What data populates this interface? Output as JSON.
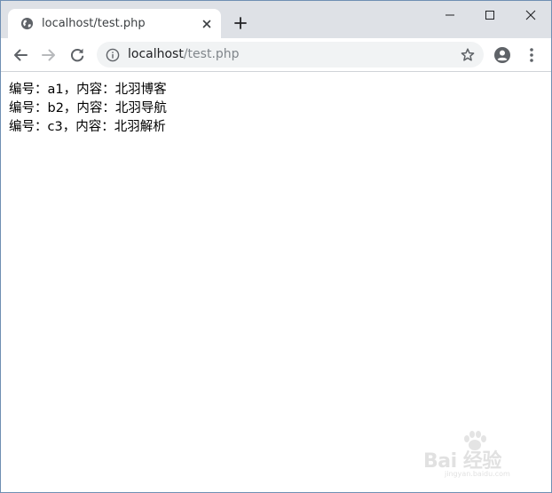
{
  "tab": {
    "title": "localhost/test.php",
    "favicon": "globe-icon",
    "close_icon": "close-icon"
  },
  "tabstrip": {
    "new_tab_icon": "plus-icon"
  },
  "window_controls": {
    "minimize_icon": "minimize-icon",
    "maximize_icon": "maximize-icon",
    "close_icon": "close-icon"
  },
  "toolbar": {
    "back_icon": "arrow-left-icon",
    "forward_icon": "arrow-right-icon",
    "reload_icon": "reload-icon",
    "profile_icon": "account-circle-icon",
    "menu_icon": "more-vertical-icon"
  },
  "omnibox": {
    "url_host": "localhost",
    "url_path": "/test.php",
    "info_icon": "info-icon",
    "bookmark_icon": "star-outline-icon"
  },
  "page": {
    "lines": [
      "编号：a1，内容：北羽博客",
      "编号：b2，内容：北羽导航",
      "编号：c3，内容：北羽解析"
    ]
  },
  "watermark": {
    "text": "Bai 经验",
    "sub": "jingyan.baidu.com"
  },
  "colors": {
    "tabstrip_bg": "#dee1e6",
    "omnibox_bg": "#f1f3f4",
    "icon": "#5f6368",
    "url_path": "#80868b"
  }
}
